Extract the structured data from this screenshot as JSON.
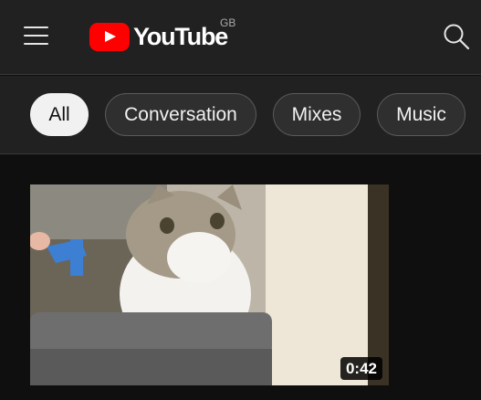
{
  "header": {
    "menu_icon": "hamburger-menu-icon",
    "logo_text": "YouTube",
    "region": "GB",
    "search_icon": "search-icon",
    "brand_color": "#ff0000"
  },
  "chips": [
    {
      "label": "All",
      "selected": true
    },
    {
      "label": "Conversation",
      "selected": false
    },
    {
      "label": "Mixes",
      "selected": false
    },
    {
      "label": "Music",
      "selected": false
    }
  ],
  "video": {
    "duration": "0:42"
  }
}
